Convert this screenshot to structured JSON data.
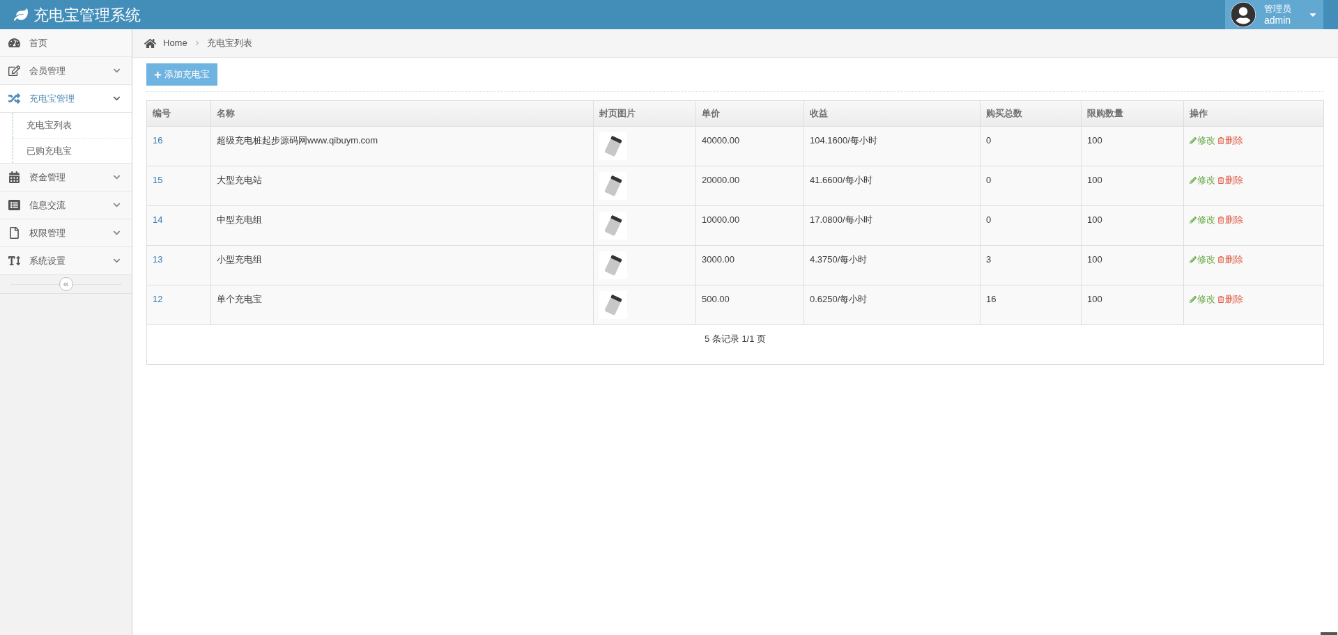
{
  "header": {
    "title": "充电宝管理系统",
    "user": {
      "role": "管理员",
      "name": "admin"
    }
  },
  "sidebar": {
    "items": [
      {
        "label": "首页",
        "selected": false,
        "expandable": false
      },
      {
        "label": "会员管理",
        "selected": false,
        "expandable": true,
        "expanded": false
      },
      {
        "label": "充电宝管理",
        "selected": true,
        "expandable": true,
        "expanded": true,
        "children": [
          {
            "label": "充电宝列表",
            "selected": false
          },
          {
            "label": "已购充电宝",
            "selected": false
          }
        ]
      },
      {
        "label": "资金管理",
        "selected": false,
        "expandable": true,
        "expanded": false
      },
      {
        "label": "信息交流",
        "selected": false,
        "expandable": true,
        "expanded": false
      },
      {
        "label": "权限管理",
        "selected": false,
        "expandable": true,
        "expanded": false
      },
      {
        "label": "系统设置",
        "selected": false,
        "expandable": true,
        "expanded": false
      }
    ]
  },
  "breadcrumb": [
    "Home",
    "充电宝列表"
  ],
  "add_button": "添加充电宝",
  "table": {
    "columns": [
      "编号",
      "名称",
      "封页图片",
      "单价",
      "收益",
      "购买总数",
      "限购数量",
      "操作"
    ],
    "rows": [
      {
        "id": "16",
        "name": "超级充电桩起步源码网www.qibuym.com",
        "price": "40000.00",
        "income": "104.1600/每小时",
        "bought": "0",
        "limit": "100",
        "actions": [
          "修改",
          "删除"
        ]
      },
      {
        "id": "15",
        "name": "大型充电站",
        "price": "20000.00",
        "income": "41.6600/每小时",
        "bought": "0",
        "limit": "100",
        "actions": [
          "修改",
          "删除"
        ]
      },
      {
        "id": "14",
        "name": "中型充电组",
        "price": "10000.00",
        "income": "17.0800/每小时",
        "bought": "0",
        "limit": "100",
        "actions": [
          "修改",
          "删除"
        ]
      },
      {
        "id": "13",
        "name": "小型充电组",
        "price": "3000.00",
        "income": "4.3750/每小时",
        "bought": "3",
        "limit": "100",
        "actions": [
          "修改",
          "删除"
        ]
      },
      {
        "id": "12",
        "name": "单个充电宝",
        "price": "500.00",
        "income": "0.6250/每小时",
        "bought": "16",
        "limit": "100",
        "actions": [
          "修改",
          "删除"
        ]
      }
    ],
    "footer": "5 条记录 1/1 页"
  }
}
